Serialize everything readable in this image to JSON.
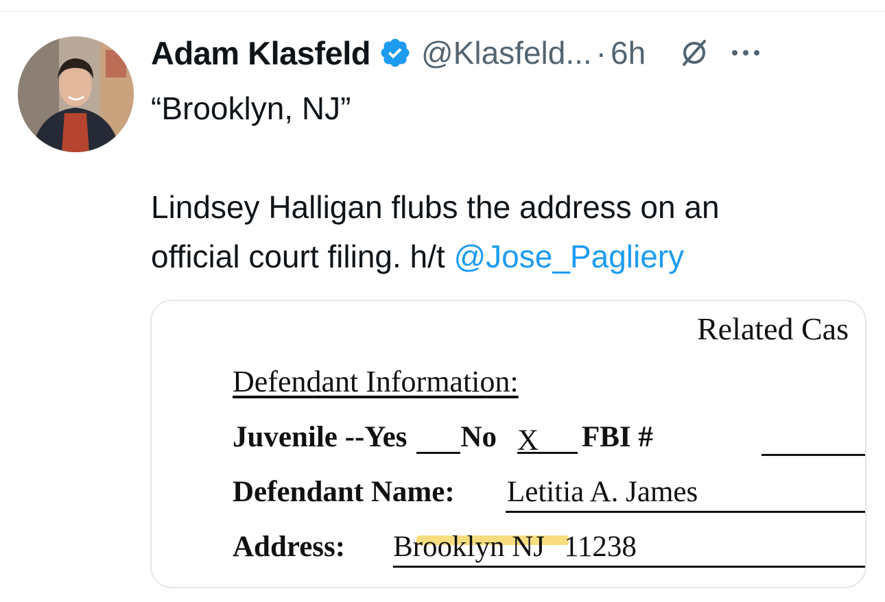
{
  "tweet": {
    "author_name": "Adam Klasfeld",
    "handle": "@Klasfeld...",
    "separator": "·",
    "time": "6h",
    "text_line1": "“Brooklyn, NJ”",
    "text_line2": "Lindsey Halligan flubs the address on an",
    "text_line3_prefix": "official court filing. h/t ",
    "mention": "@Jose_Pagliery"
  },
  "icons": {
    "verified": "verified-badge-icon",
    "grok": "grok-icon",
    "more": "more-icon"
  },
  "colors": {
    "verified": "#1d9bf0",
    "link": "#1d9bf0",
    "secondary_text": "#536471",
    "highlight": "#f7d769"
  },
  "document": {
    "related": "Related Cas",
    "section_heading": "Defendant Information:",
    "juvenile_label": "Juvenile --Yes",
    "no_label": "No",
    "no_value": "X",
    "fbi_label": "FBI #",
    "name_label": "Defendant Name:",
    "name_value": "Letitia A. James",
    "address_label": "Address:",
    "address_value": "Brooklyn NJ",
    "zip_value": "11238"
  }
}
